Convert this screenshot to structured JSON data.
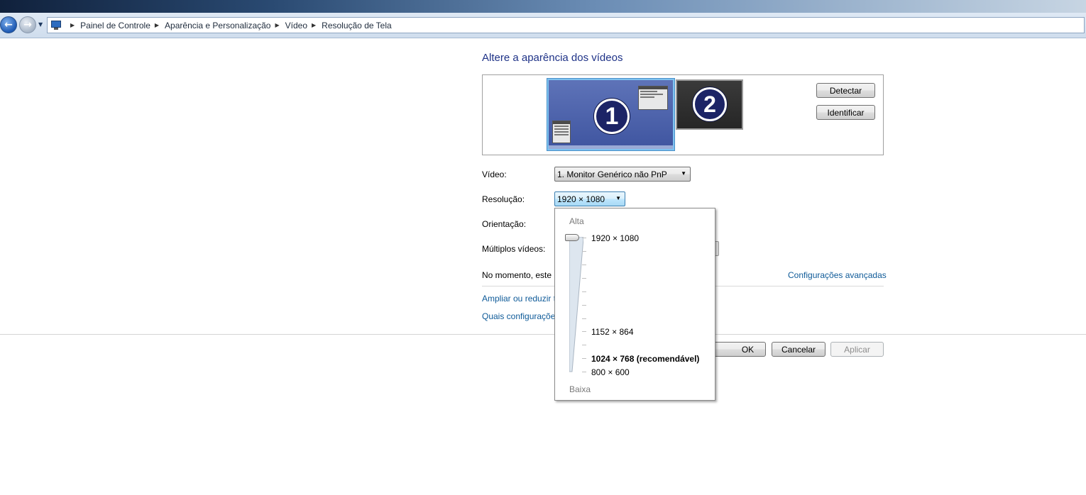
{
  "breadcrumb": {
    "items": [
      "Painel de Controle",
      "Aparência e Personalização",
      "Vídeo",
      "Resolução de Tela"
    ]
  },
  "main": {
    "heading": "Altere a aparência dos vídeos",
    "monitors": [
      {
        "number": "1",
        "selected": true
      },
      {
        "number": "2",
        "selected": false
      }
    ],
    "detect_label": "Detectar",
    "identify_label": "Identificar",
    "video_label": "Vídeo:",
    "video_value": "1. Monitor Genérico não PnP",
    "resolution_label": "Resolução:",
    "resolution_value": "1920 × 1080",
    "orientation_label": "Orientação:",
    "multiple_label": "Múltiplos vídeos:",
    "status_text": "No momento, este",
    "advanced_link": "Configurações avançadas",
    "link_enlarge": "Ampliar ou reduzir t",
    "link_which": "Quais configuraçõe",
    "ok_label": "OK",
    "cancel_label": "Cancelar",
    "apply_label": "Aplicar"
  },
  "resolution_popup": {
    "high_label": "Alta",
    "low_label": "Baixa",
    "options": [
      "1920 × 1080",
      "1152 × 864",
      "1024 × 768 (recomendável)",
      "800 × 600"
    ],
    "selected": "1920 × 1080"
  },
  "colors": {
    "heading": "#1e3287",
    "link": "#0e5a98",
    "monitor_selected_border": "#7ec2f0"
  }
}
